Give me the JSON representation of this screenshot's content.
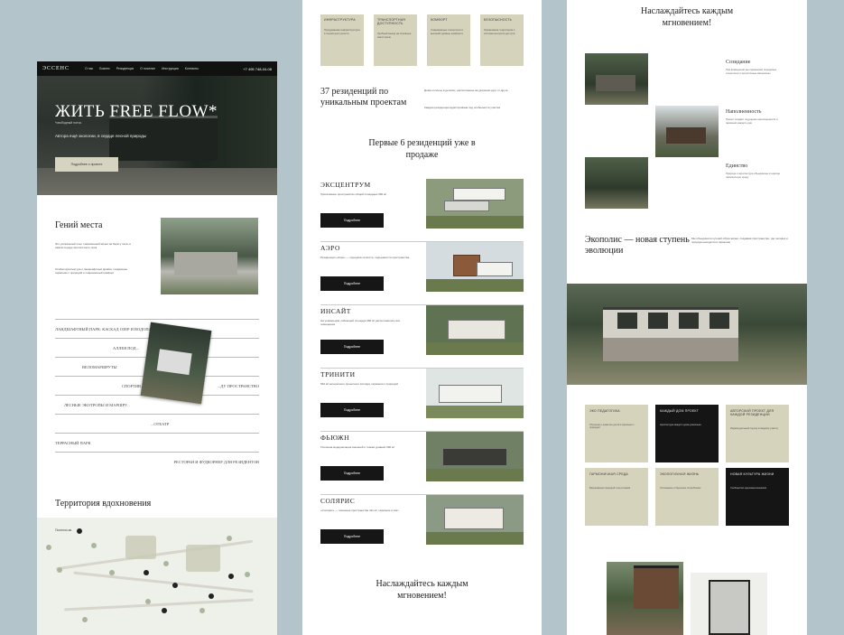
{
  "header": {
    "logo": "ЭССЕНС",
    "nav": [
      "О нас",
      "Бизнес",
      "Резиденции",
      "О поселке",
      "Инструкция",
      "Контакты"
    ],
    "phone": "+7 495 748-04-08"
  },
  "hero": {
    "title": "ЖИТЬ FREE FLOW*",
    "subtitle": "*свободный поток",
    "tagline": "Автора ещё экологии, в сердце лесной природы",
    "cta": "Подробнее о проекте"
  },
  "genius": {
    "title": "Гений места",
    "p1": "Это уникальный опыт современной жизни на берегу леса, в самом сердце экологичного леса",
    "p2": "Особая архитектура и ландшафтный дизайн, создающие гармонию с природой и современный комфорт"
  },
  "features": [
    {
      "label": "ЛАНДШАФТНЫЙ ПАРК: КАСКАД ОЗЕР И ВОДОПАДОВ",
      "right": ""
    },
    {
      "label": "",
      "right": "АЛЛЕЯ ПОД..."
    },
    {
      "label": "ВЕЛОМАРШРУТЫ",
      "right": ""
    },
    {
      "label": "СПОРТИВ...",
      "right": "...ДУ ПРОСТРАНСТВО"
    },
    {
      "label": "ЛЕСНЫЕ ЭКОТРОПЫ И МАРШРУ...",
      "right": ""
    },
    {
      "label": "",
      "right": "...ОТЕАТР"
    },
    {
      "label": "ТЕРРАСНЫЙ ПАРК",
      "right": ""
    },
    {
      "label": "",
      "right": "РЕСТОРАН И ФУДКОРНЕР ДЛЯ РЕЗИДЕНТОВ"
    }
  ],
  "territory": {
    "title": "Территория вдохновения",
    "legend": "Поселок кв."
  },
  "cards": [
    {
      "title": "ИНФРАСТРУКТУРА",
      "desc": "Продуманная инфраструктура в пешей доступности"
    },
    {
      "title": "ТРАНСПОРТНАЯ ДОСТУПНОСТЬ",
      "desc": "Удобный выезд на основные магистрали"
    },
    {
      "title": "КОМФОРТ",
      "desc": "Современные технологии и высокий уровень комфорта"
    },
    {
      "title": "БЕЗОПАСНОСТЬ",
      "desc": "Охраняемая территория и система контроля доступа"
    }
  ],
  "stat": {
    "title": "37 резиденций по уникальным проектам",
    "desc1": "Дома отличны в деталях, расположены на удалении друг от друга",
    "desc2": "Каждая резиденция адаптирована под особенности участка"
  },
  "first6": {
    "title": "Первые 6 резиденций уже в продаже"
  },
  "residences": [
    {
      "name": "ЭКСЦЕНТРУМ",
      "desc": "Трёхэтажное пространство общей площадью 360 м²",
      "more": "Подробнее"
    },
    {
      "name": "АЭРО",
      "desc": "Резиденция «Аэро» — передача легкости, подъемности пространства",
      "more": "Подробнее"
    },
    {
      "name": "ИНСАЙТ",
      "desc": "На уникальном лобеющей площади 360 м² расположились все помещения",
      "more": "Подробнее"
    },
    {
      "name": "ТРИНИТИ",
      "desc": "540 м² интересного проектного взгляда, гармония с природой",
      "more": "Подробнее"
    },
    {
      "name": "ФЬЮЖН",
      "desc": "Усиленна модернизация внешней и тонкая уравнии 360 м²",
      "more": "Подробнее"
    },
    {
      "name": "СОЛЯРИС",
      "desc": "«Солярис» — пленение пространства 411 м², гармония и свет",
      "more": "Подробнее"
    }
  ],
  "enjoy": {
    "title": "Наслаждайтесь каждым мгновением!"
  },
  "values": [
    {
      "title": "Созидание",
      "desc": "При возведении мы применяем передовые технологии и экологичные материалы"
    },
    {
      "title": "Наполненность",
      "desc": "Проект создаёт ощущение наполненности и гармонии каждого дня"
    },
    {
      "title": "Единство",
      "desc": "Природа и архитектура объединены в единую гармоничную среду"
    }
  ],
  "eco": {
    "title": "Экополис — новая ступень эволюции",
    "desc": "Мы объединили лучший образ жизни, создавая пространство, где человек и природа находятся в гармонии"
  },
  "grid": [
    {
      "title": "ЭКО ПЕДАГОГИКА",
      "desc": "Обучение и развитие детей в гармонии с природой",
      "dark": false
    },
    {
      "title": "КАЖДЫЙ ДОМ ПРОЕКТ",
      "desc": "Архитектура каждого дома уникальна",
      "dark": true
    },
    {
      "title": "АВТОРСКИЙ ПРОЕКТ ДЛЯ КАЖДОЙ РЕЗИДЕНЦИИ",
      "desc": "Индивидуальный подход к каждому участку",
      "dark": false
    },
    {
      "title": "ГАРМОНИЧНАЯ СРЕДА",
      "desc": "Вдохновение природой и её ритмами",
      "dark": false
    },
    {
      "title": "ЭКОЛОГИЧНАЯ ЖИЗНЬ",
      "desc": "Осознанное и бережное потребление",
      "dark": false
    },
    {
      "title": "НОВАЯ КУЛЬТУРА ЖИЗНИ",
      "desc": "Сообщество единомышленников",
      "dark": true
    }
  ]
}
